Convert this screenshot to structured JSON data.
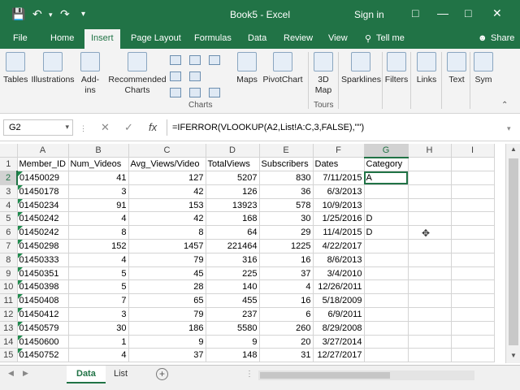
{
  "titlebar": {
    "title": "Book5 - Excel",
    "signin": "Sign in",
    "accent": "#217346"
  },
  "ribbon_tabs": [
    "File",
    "Home",
    "Insert",
    "Page Layout",
    "Formulas",
    "Data",
    "Review",
    "View",
    "Tell me",
    "Share"
  ],
  "ribbon": {
    "tables": "Tables",
    "illustrations": "Illustrations",
    "addins_1": "Add-",
    "addins_2": "ins",
    "rec_1": "Recommended",
    "rec_2": "Charts",
    "charts_group": "Charts",
    "maps": "Maps",
    "pivotchart": "PivotChart",
    "map3d_1": "3D",
    "map3d_2": "Map",
    "tours_group": "Tours",
    "sparklines": "Sparklines",
    "filters": "Filters",
    "links": "Links",
    "text": "Text",
    "symbols": "Sym"
  },
  "formula_bar": {
    "name_box": "G2",
    "formula": "=IFERROR(VLOOKUP(A2,List!A:C,3,FALSE),\"\")"
  },
  "columns": [
    "A",
    "B",
    "C",
    "D",
    "E",
    "F",
    "G",
    "H",
    "I"
  ],
  "rows": [
    [
      "Member_ID",
      "Num_Videos",
      "Avg_Views/Video",
      "TotalViews",
      "Subscribers",
      "Dates",
      "Category",
      "",
      ""
    ],
    [
      "01450029",
      "41",
      "127",
      "5207",
      "830",
      "7/11/2015",
      "A",
      "",
      ""
    ],
    [
      "01450178",
      "3",
      "42",
      "126",
      "36",
      "6/3/2013",
      "",
      "",
      ""
    ],
    [
      "01450234",
      "91",
      "153",
      "13923",
      "578",
      "10/9/2013",
      "",
      "",
      ""
    ],
    [
      "01450242",
      "4",
      "42",
      "168",
      "30",
      "1/25/2016",
      "D",
      "",
      ""
    ],
    [
      "01450242",
      "8",
      "8",
      "64",
      "29",
      "11/4/2015",
      "D",
      "",
      ""
    ],
    [
      "01450298",
      "152",
      "1457",
      "221464",
      "1225",
      "4/22/2017",
      "",
      "",
      ""
    ],
    [
      "01450333",
      "4",
      "79",
      "316",
      "16",
      "8/6/2013",
      "",
      "",
      ""
    ],
    [
      "01450351",
      "5",
      "45",
      "225",
      "37",
      "3/4/2010",
      "",
      "",
      ""
    ],
    [
      "01450398",
      "5",
      "28",
      "140",
      "4",
      "12/26/2011",
      "",
      "",
      ""
    ],
    [
      "01450408",
      "7",
      "65",
      "455",
      "16",
      "5/18/2009",
      "",
      "",
      ""
    ],
    [
      "01450412",
      "3",
      "79",
      "237",
      "6",
      "6/9/2011",
      "",
      "",
      ""
    ],
    [
      "01450579",
      "30",
      "186",
      "5580",
      "260",
      "8/29/2008",
      "",
      "",
      ""
    ],
    [
      "01450600",
      "1",
      "9",
      "9",
      "20",
      "3/27/2014",
      "",
      "",
      ""
    ],
    [
      "01450752",
      "4",
      "37",
      "148",
      "31",
      "12/27/2017",
      "",
      "",
      ""
    ]
  ],
  "sheets": [
    "Data",
    "List"
  ]
}
